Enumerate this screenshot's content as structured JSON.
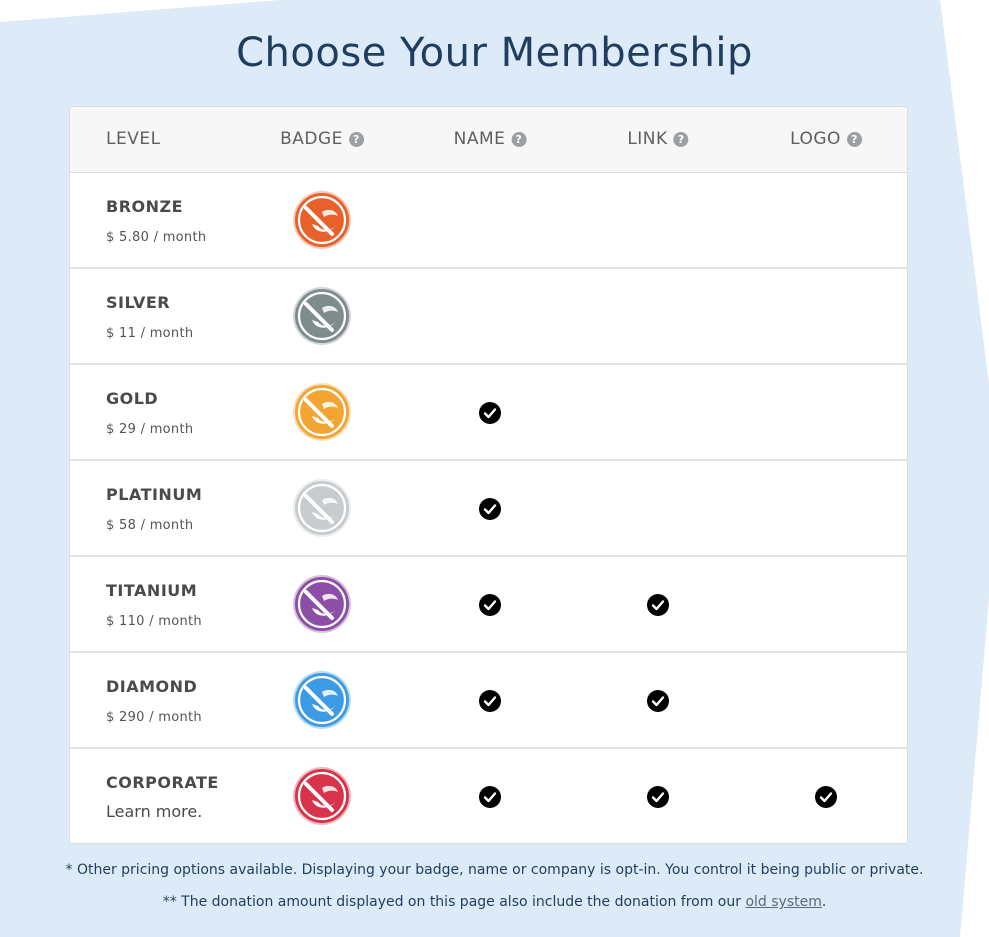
{
  "title": "Choose Your Membership",
  "columns": {
    "level": "LEVEL",
    "badge": "BADGE",
    "name": "NAME",
    "link": "LINK",
    "logo": "LOGO"
  },
  "tiers": [
    {
      "name": "BRONZE",
      "price": "$ 5.80 / month",
      "badge_color": "#e8602a",
      "name_perk": false,
      "link_perk": false,
      "logo_perk": false
    },
    {
      "name": "SILVER",
      "price": "$ 11 / month",
      "badge_color": "#7f8c8d",
      "name_perk": false,
      "link_perk": false,
      "logo_perk": false
    },
    {
      "name": "GOLD",
      "price": "$ 29 / month",
      "badge_color": "#f3a533",
      "name_perk": true,
      "link_perk": false,
      "logo_perk": false
    },
    {
      "name": "PLATINUM",
      "price": "$ 58 / month",
      "badge_color": "#c9ccce",
      "name_perk": true,
      "link_perk": false,
      "logo_perk": false
    },
    {
      "name": "TITANIUM",
      "price": "$ 110 / month",
      "badge_color": "#8d4ea8",
      "name_perk": true,
      "link_perk": true,
      "logo_perk": false
    },
    {
      "name": "DIAMOND",
      "price": "$ 290 / month",
      "badge_color": "#3d9be6",
      "name_perk": true,
      "link_perk": true,
      "logo_perk": false
    },
    {
      "name": "CORPORATE",
      "price_link": "Learn more.",
      "badge_color": "#d7334a",
      "name_perk": true,
      "link_perk": true,
      "logo_perk": true
    }
  ],
  "footnotes": {
    "pricing": "* Other pricing options available. Displaying your badge, name or company is opt-in. You control it being public or private.",
    "donation_prefix": "** The donation amount displayed on this page also include the donation from our ",
    "donation_link": "old system",
    "donation_suffix": "."
  },
  "icons": {
    "help": "question-circle-icon",
    "check": "check-circle-icon",
    "badge": "wing-badge-icon"
  },
  "colors": {
    "background": "#ddeaf8",
    "title": "#1f3d5e"
  }
}
